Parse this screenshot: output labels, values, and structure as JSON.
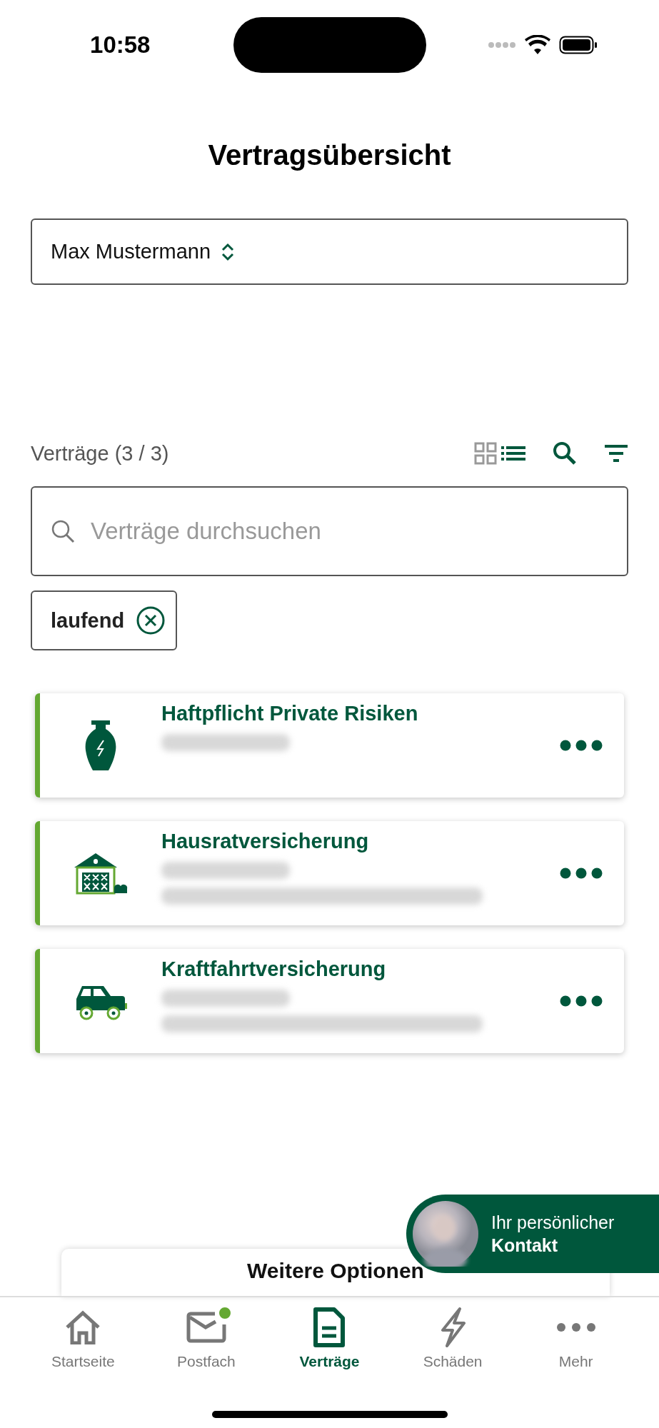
{
  "status_bar": {
    "time": "10:58"
  },
  "title": "Vertragsübersicht",
  "person_select": {
    "value": "Max Mustermann"
  },
  "contracts": {
    "heading": "Verträge (3 / 3)",
    "view_toggle": [
      {
        "kind": "grid",
        "selected": false
      },
      {
        "kind": "list",
        "selected": true
      }
    ],
    "search": {
      "placeholder": "Verträge durchsuchen"
    },
    "filters": [
      {
        "label": "laufend"
      }
    ],
    "items": [
      {
        "title": "Haftpflicht Private Risiken",
        "kind": "vase",
        "blurred_lines": [
          {
            "kind": "short"
          }
        ]
      },
      {
        "title": "Hausratversicherung",
        "kind": "barn",
        "blurred_lines": [
          {
            "kind": "short"
          },
          {
            "kind": "long"
          }
        ]
      },
      {
        "title": "Kraftfahrtversicherung",
        "kind": "car",
        "blurred_lines": [
          {
            "kind": "short"
          },
          {
            "kind": "long"
          }
        ]
      }
    ]
  },
  "more_options": {
    "title": "Weitere Optionen"
  },
  "contact": {
    "line_1": "Ihr persönlicher",
    "line_2": "Kontakt"
  },
  "tabs": [
    {
      "label": "Startseite",
      "kind": "home",
      "selected": false,
      "unread": false
    },
    {
      "label": "Postfach",
      "kind": "mail",
      "selected": false,
      "unread": true
    },
    {
      "label": "Verträge",
      "kind": "document",
      "selected": true,
      "unread": false
    },
    {
      "label": "Schäden",
      "kind": "bolt",
      "selected": false,
      "unread": false
    },
    {
      "label": "Mehr",
      "kind": "more",
      "selected": false,
      "unread": false
    }
  ]
}
